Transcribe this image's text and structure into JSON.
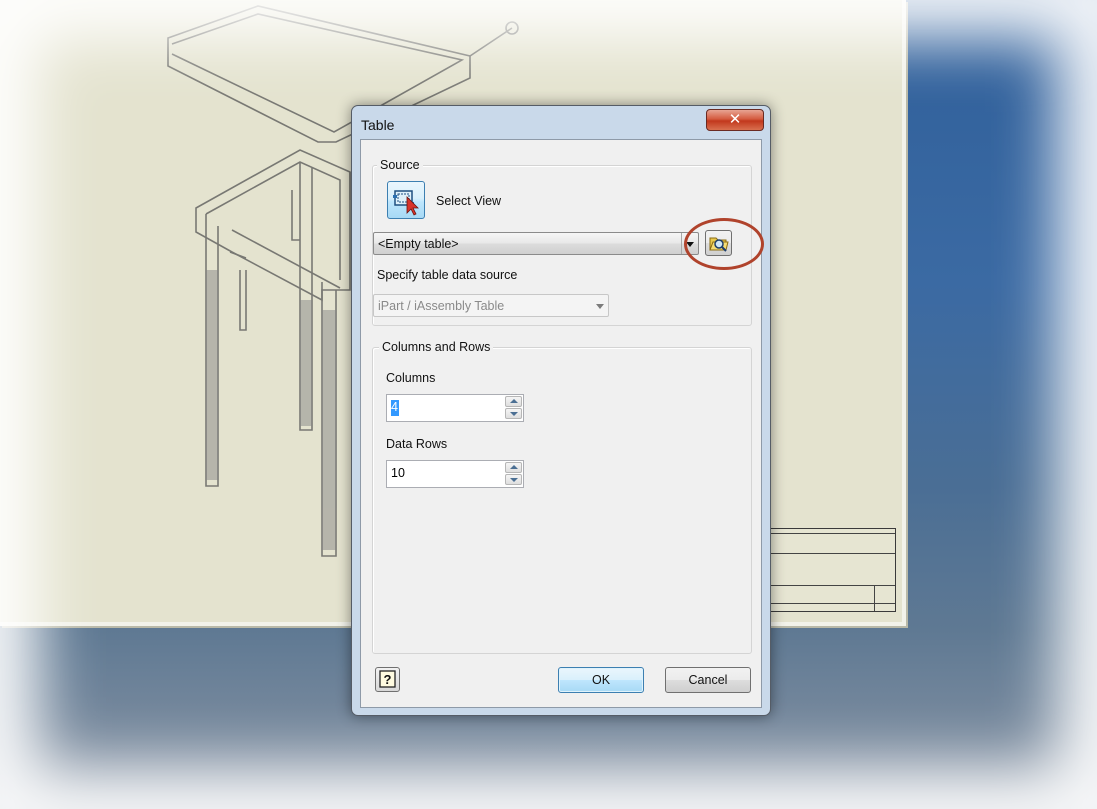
{
  "dialog": {
    "title": "Table",
    "close_glyph": "✕"
  },
  "source": {
    "group_label": "Source",
    "select_view_label": "Select View",
    "select_view_icon": "select-view-cursor-icon",
    "table_combo_value": "<Empty table>",
    "browse_icon": "open-folder-icon",
    "specify_label": "Specify table data source",
    "data_source_value": "iPart / iAssembly Table"
  },
  "columns_rows": {
    "group_label": "Columns and Rows",
    "columns_label": "Columns",
    "columns_value": "4",
    "data_rows_label": "Data Rows",
    "data_rows_value": "10"
  },
  "footer": {
    "help_icon": "help-question-icon",
    "ok_label": "OK",
    "cancel_label": "Cancel"
  },
  "colors": {
    "annotation_ring": "#b0432c",
    "dialog_frame": "#c9d9ea",
    "close_button": "#c2381d",
    "sheet_background": "#e4e3cf",
    "workspace_blue": "#3b6aa3"
  }
}
